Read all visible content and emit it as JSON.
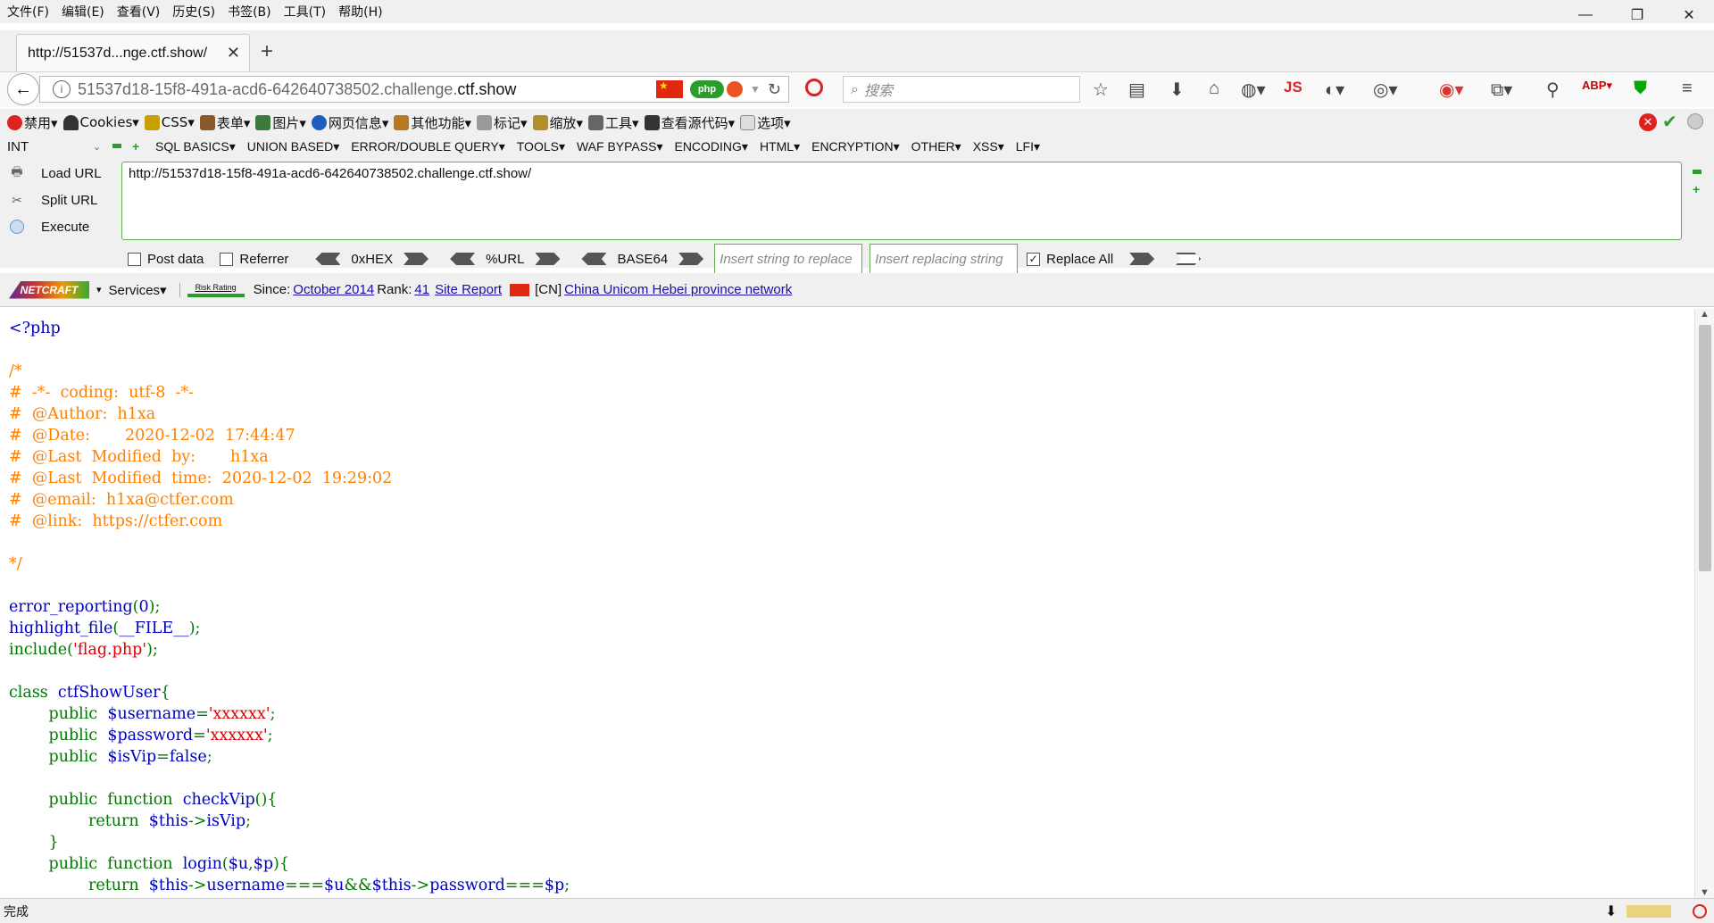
{
  "menubar": {
    "items": [
      "文件(F)",
      "编辑(E)",
      "查看(V)",
      "历史(S)",
      "书签(B)",
      "工具(T)",
      "帮助(H)"
    ]
  },
  "window": {
    "minimize": "—",
    "maximize": "❐",
    "close": "✕"
  },
  "tab": {
    "title": "http://51537d...nge.ctf.show/",
    "close": "✕",
    "new": "+"
  },
  "nav": {
    "url_prefix": "51537d18-15f8-491a-acd6-642640738502.challenge.",
    "url_domain": "ctf.show",
    "search_placeholder": "搜索",
    "js_label": "JS"
  },
  "hackbar1": {
    "items": [
      "禁用▾",
      "Cookies▾",
      "CSS▾",
      "表单▾",
      "图片▾",
      "网页信息▾",
      "其他功能▾",
      "标记▾",
      "缩放▾",
      "工具▾",
      "查看源代码▾",
      "选项▾"
    ]
  },
  "hackbar2": {
    "select": "INT",
    "menus": [
      "SQL BASICS▾",
      "UNION BASED▾",
      "ERROR/DOUBLE QUERY▾",
      "TOOLS▾",
      "WAF BYPASS▾",
      "ENCODING▾",
      "HTML▾",
      "ENCRYPTION▾",
      "OTHER▾",
      "XSS▾",
      "LFI▾"
    ]
  },
  "hackbar_left": {
    "load": "Load URL",
    "split": "Split URL",
    "execute": "Execute"
  },
  "hackbar_url": "http://51537d18-15f8-491a-acd6-642640738502.challenge.ctf.show/",
  "options": {
    "post": "Post data",
    "referrer": "Referrer",
    "hex": "0xHEX",
    "url": "%URL",
    "base64": "BASE64",
    "insert_placeholder": "Insert string to replace",
    "replacing_placeholder": "Insert replacing string",
    "replace_all": "Replace All"
  },
  "netcraft": {
    "logo": "NETCRAFT",
    "services": "Services▾",
    "risk": "Risk Rating",
    "since_label": "Since:",
    "since_value": "October 2014",
    "rank_label": "Rank:",
    "rank_value": "41",
    "site_report": "Site Report",
    "country": "[CN]",
    "network": "China Unicom Hebei province network"
  },
  "code_lines": [
    [
      [
        "df",
        "<?php"
      ]
    ],
    [],
    [
      [
        "cm",
        "/*"
      ]
    ],
    [
      [
        "cm",
        "#  -*-  coding:  utf-8  -*-"
      ]
    ],
    [
      [
        "cm",
        "#  @Author:  h1xa"
      ]
    ],
    [
      [
        "cm",
        "#  @Date:       2020-12-02  17:44:47"
      ]
    ],
    [
      [
        "cm",
        "#  @Last  Modified  by:       h1xa"
      ]
    ],
    [
      [
        "cm",
        "#  @Last  Modified  time:  2020-12-02  19:29:02"
      ]
    ],
    [
      [
        "cm",
        "#  @email:  h1xa@ctfer.com"
      ]
    ],
    [
      [
        "cm",
        "#  @link:  https://ctfer.com"
      ]
    ],
    [],
    [
      [
        "cm",
        "*/"
      ]
    ],
    [],
    [
      [
        "df",
        "error_reporting"
      ],
      [
        "kw",
        "("
      ],
      [
        "df",
        "0"
      ],
      [
        "kw",
        ");"
      ]
    ],
    [
      [
        "df",
        "highlight_file"
      ],
      [
        "kw",
        "("
      ],
      [
        "df",
        "__FILE__"
      ],
      [
        "kw",
        ");"
      ]
    ],
    [
      [
        "kw",
        "include("
      ],
      [
        "st",
        "'flag.php'"
      ],
      [
        "kw",
        ");"
      ]
    ],
    [],
    [
      [
        "kw",
        "class  "
      ],
      [
        "df",
        "ctfShowUser"
      ],
      [
        "kw",
        "{"
      ]
    ],
    [
      [
        "kw",
        "        public  "
      ],
      [
        "df",
        "$username"
      ],
      [
        "kw",
        "="
      ],
      [
        "st",
        "'xxxxxx'"
      ],
      [
        "kw",
        ";"
      ]
    ],
    [
      [
        "kw",
        "        public  "
      ],
      [
        "df",
        "$password"
      ],
      [
        "kw",
        "="
      ],
      [
        "st",
        "'xxxxxx'"
      ],
      [
        "kw",
        ";"
      ]
    ],
    [
      [
        "kw",
        "        public  "
      ],
      [
        "df",
        "$isVip"
      ],
      [
        "kw",
        "="
      ],
      [
        "df",
        "false"
      ],
      [
        "kw",
        ";"
      ]
    ],
    [],
    [
      [
        "kw",
        "        public  function  "
      ],
      [
        "df",
        "checkVip"
      ],
      [
        "kw",
        "(){"
      ]
    ],
    [
      [
        "kw",
        "                return  "
      ],
      [
        "df",
        "$this"
      ],
      [
        "kw",
        "->"
      ],
      [
        "df",
        "isVip"
      ],
      [
        "kw",
        ";"
      ]
    ],
    [
      [
        "kw",
        "        }"
      ]
    ],
    [
      [
        "kw",
        "        public  function  "
      ],
      [
        "df",
        "login"
      ],
      [
        "kw",
        "("
      ],
      [
        "df",
        "$u"
      ],
      [
        "kw",
        ","
      ],
      [
        "df",
        "$p"
      ],
      [
        "kw",
        "){"
      ]
    ],
    [
      [
        "kw",
        "                return  "
      ],
      [
        "df",
        "$this"
      ],
      [
        "kw",
        "->"
      ],
      [
        "df",
        "username"
      ],
      [
        "kw",
        "==="
      ],
      [
        "df",
        "$u"
      ],
      [
        "kw",
        "&&"
      ],
      [
        "df",
        "$this"
      ],
      [
        "kw",
        "->"
      ],
      [
        "df",
        "password"
      ],
      [
        "kw",
        "==="
      ],
      [
        "df",
        "$p"
      ],
      [
        "kw",
        ";"
      ]
    ]
  ],
  "colors": {
    "keyword": "#007700",
    "default": "#0000bb",
    "string": "#dd0000",
    "comment": "#ff8000"
  },
  "status": {
    "text": "完成"
  }
}
